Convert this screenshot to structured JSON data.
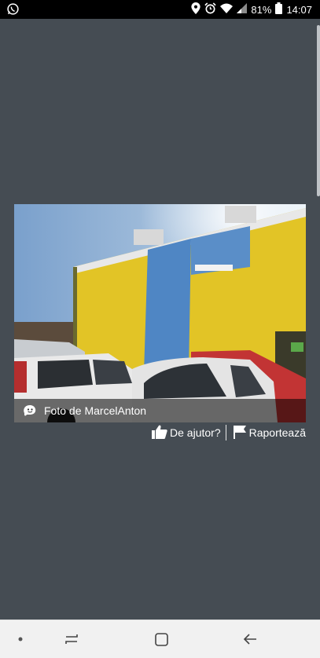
{
  "status_bar": {
    "battery_percent": "81%",
    "time": "14:07",
    "icons": [
      "whatsapp-icon",
      "location-icon",
      "alarm-icon",
      "wifi-icon",
      "signal-icon",
      "battery-icon"
    ]
  },
  "photo": {
    "caption_prefix": "Foto de",
    "author": "MarcelAnton",
    "caption_icon": "waze-icon"
  },
  "actions": {
    "helpful_label": "De ajutor?",
    "report_label": "Raportează",
    "helpful_icon": "thumbs-up-icon",
    "report_icon": "flag-icon"
  },
  "nav_bar": {
    "icons": [
      "dot-icon",
      "recents-icon",
      "home-icon",
      "back-icon"
    ]
  },
  "colors": {
    "background": "#454c53",
    "status_bar": "#000000",
    "nav_bar": "#f1f1f1"
  }
}
